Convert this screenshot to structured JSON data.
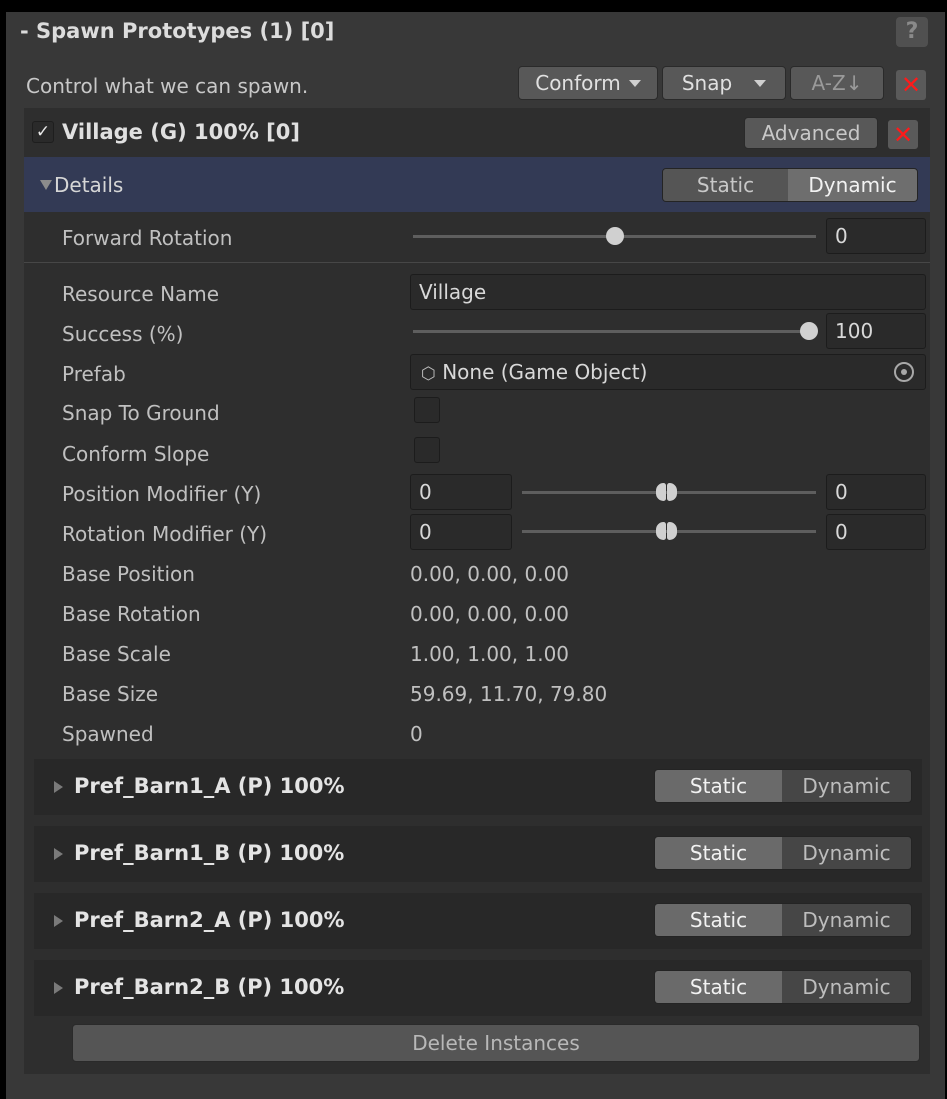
{
  "header": {
    "title": "- Spawn Prototypes (1) [0]",
    "help_label": "?",
    "description": "Control what we can spawn.",
    "conform_label": "Conform",
    "snap_label": "Snap",
    "sort_label": "A-Z↓",
    "remove_label": "✕"
  },
  "village": {
    "checked_mark": "✓",
    "title": "Village (G) 100% [0]",
    "advanced_label": "Advanced",
    "remove_label": "✕"
  },
  "details": {
    "label": "Details",
    "static_label": "Static",
    "dynamic_label": "Dynamic"
  },
  "forward_rotation": {
    "label": "Forward Rotation",
    "value": "0",
    "slider_fraction": 0.5
  },
  "props": {
    "resource_name_label": "Resource Name",
    "resource_name_value": "Village",
    "success_label": "Success (%)",
    "success_value": "100",
    "prefab_label": "Prefab",
    "prefab_value": "None (Game Object)",
    "snap_label": "Snap To Ground",
    "conform_label": "Conform Slope",
    "pos_mod_label": "Position Modifier (Y)",
    "pos_mod_min": "0",
    "pos_mod_max": "0",
    "rot_mod_label": "Rotation Modifier (Y)",
    "rot_mod_min": "0",
    "rot_mod_max": "0",
    "base_position_label": "Base Position",
    "base_position_value": "0.00, 0.00, 0.00",
    "base_rotation_label": "Base Rotation",
    "base_rotation_value": "0.00, 0.00, 0.00",
    "base_scale_label": "Base Scale",
    "base_scale_value": "1.00, 1.00, 1.00",
    "base_size_label": "Base Size",
    "base_size_value": "59.69, 11.70, 79.80",
    "spawned_label": "Spawned",
    "spawned_value": "0"
  },
  "prototypes": [
    {
      "title": "Pref_Barn1_A (P) 100%",
      "static_label": "Static",
      "dynamic_label": "Dynamic"
    },
    {
      "title": "Pref_Barn1_B (P) 100%",
      "static_label": "Static",
      "dynamic_label": "Dynamic"
    },
    {
      "title": "Pref_Barn2_A (P) 100%",
      "static_label": "Static",
      "dynamic_label": "Dynamic"
    },
    {
      "title": "Pref_Barn2_B (P) 100%",
      "static_label": "Static",
      "dynamic_label": "Dynamic"
    }
  ],
  "delete_label": "Delete Instances",
  "colors": {
    "selected_row": "#333a55",
    "remove_red": "#ff1a1a"
  }
}
